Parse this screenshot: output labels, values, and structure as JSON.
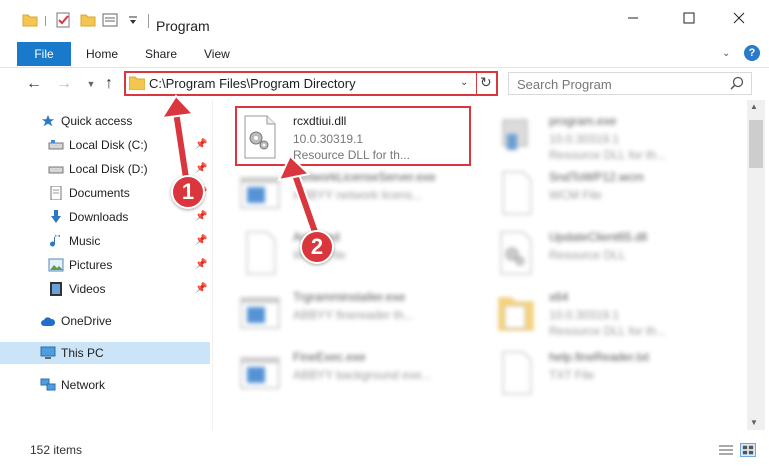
{
  "window": {
    "title": "Program",
    "minimize_icon": "minimize-icon",
    "maximize_icon": "maximize-icon",
    "close_icon": "close-icon"
  },
  "ribbon": {
    "tabs": [
      {
        "label": "File"
      },
      {
        "label": "Home"
      },
      {
        "label": "Share"
      },
      {
        "label": "View"
      }
    ]
  },
  "address": {
    "path": "C:\\Program Files\\Program Directory"
  },
  "search": {
    "placeholder": "Search Program"
  },
  "nav_pane": {
    "items": [
      {
        "label": "Quick access",
        "icon": "star-icon",
        "pinned": false
      },
      {
        "label": "Local Disk (C:)",
        "icon": "drive-icon",
        "pinned": true
      },
      {
        "label": "Local Disk (D:)",
        "icon": "drive-icon",
        "pinned": true
      },
      {
        "label": "Documents",
        "icon": "documents-icon",
        "pinned": true
      },
      {
        "label": "Downloads",
        "icon": "download-icon",
        "pinned": true
      },
      {
        "label": "Music",
        "icon": "music-icon",
        "pinned": true
      },
      {
        "label": "Pictures",
        "icon": "pictures-icon",
        "pinned": true
      },
      {
        "label": "Videos",
        "icon": "videos-icon",
        "pinned": true
      },
      {
        "label": "OneDrive",
        "icon": "cloud-icon",
        "pinned": false
      },
      {
        "label": "This PC",
        "icon": "computer-icon",
        "pinned": false,
        "selected": true
      },
      {
        "label": "Network",
        "icon": "network-icon",
        "pinned": false
      }
    ]
  },
  "files": [
    {
      "name": "rcxdtiui.dll",
      "line2": "10.0.30319.1",
      "line3": "Resource DLL for th...",
      "icon": "dll-gear-icon",
      "highlighted": true
    },
    {
      "name": "program.exe",
      "line2": "10.0.30319.1",
      "line3": "Resource DLL for th...",
      "icon": "exe-icon"
    },
    {
      "name": "NetworkLicenseServer.exe",
      "line2": "ABBYY network licens...",
      "line3": "",
      "icon": "window-app-icon"
    },
    {
      "name": "SndToWP12.wcm",
      "line2": "WCM File",
      "line3": "",
      "icon": "blank-file-icon"
    },
    {
      "name": "Archived",
      "line2": "WCM File",
      "line3": "",
      "icon": "blank-file-icon"
    },
    {
      "name": "UpdateClient65.dll",
      "line2": "Resource DLL",
      "line3": "",
      "icon": "dll-gear-icon"
    },
    {
      "name": "TrgramminstaIler.exe",
      "line2": "ABBYY finereader th...",
      "line3": "",
      "icon": "window-app-icon"
    },
    {
      "name": "x64",
      "line2": "10.0.30319.1",
      "line3": "Resource DLL for th...",
      "icon": "folder-icon"
    },
    {
      "name": "FineExec.exe",
      "line2": "ABBYY background exe...",
      "line3": "",
      "icon": "window-app-icon"
    },
    {
      "name": "help.fineReader.txt",
      "line2": "TXT File",
      "line3": "",
      "icon": "blank-file-icon"
    }
  ],
  "status": {
    "items_count": "152 items"
  },
  "callouts": [
    {
      "number": "1"
    },
    {
      "number": "2"
    }
  ],
  "colors": {
    "accent": "#1979ca",
    "highlight_red": "#d9363e",
    "selected_nav": "#cce4f7"
  }
}
